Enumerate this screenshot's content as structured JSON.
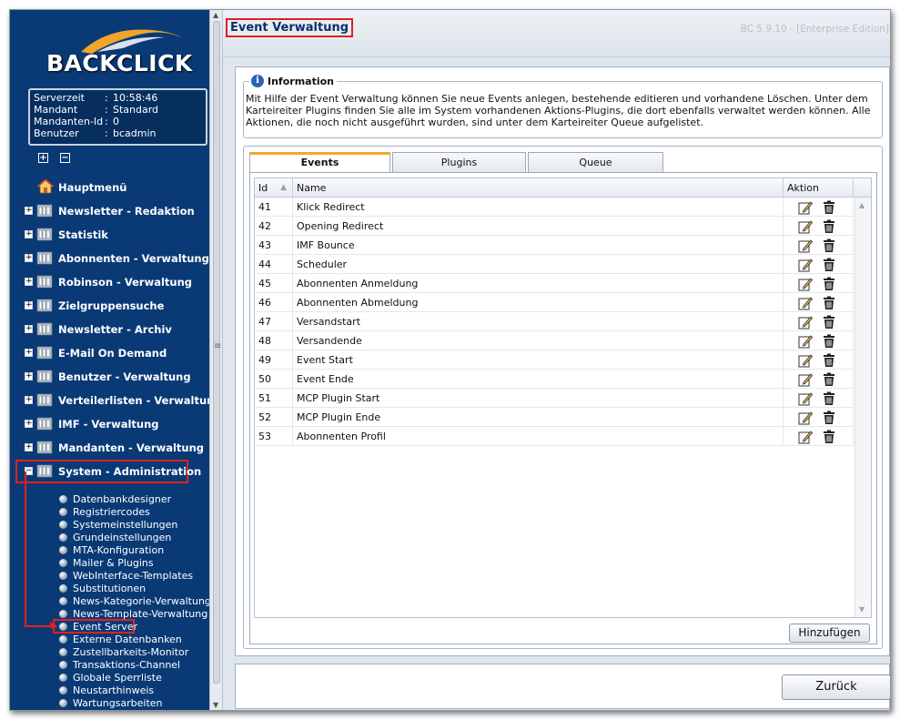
{
  "sidebar": {
    "logo_text": "BACKCLICK",
    "server_info": [
      {
        "key": "Serverzeit",
        "value": "10:58:46"
      },
      {
        "key": "Mandant",
        "value": "Standard"
      },
      {
        "key": "Mandanten-Id",
        "value": "0"
      },
      {
        "key": "Benutzer",
        "value": "bcadmin"
      }
    ],
    "expand_all": "+",
    "collapse_all": "−",
    "home_label": "Hauptmenü",
    "items": [
      {
        "label": "Newsletter - Redaktion",
        "toggle": "+"
      },
      {
        "label": "Statistik",
        "toggle": "+"
      },
      {
        "label": "Abonnenten - Verwaltung",
        "toggle": "+"
      },
      {
        "label": "Robinson - Verwaltung",
        "toggle": "+"
      },
      {
        "label": "Zielgruppensuche",
        "toggle": "+"
      },
      {
        "label": "Newsletter - Archiv",
        "toggle": "+"
      },
      {
        "label": "E-Mail On Demand",
        "toggle": "+"
      },
      {
        "label": "Benutzer - Verwaltung",
        "toggle": "+"
      },
      {
        "label": "Verteilerlisten - Verwaltung",
        "toggle": "+"
      },
      {
        "label": "IMF - Verwaltung",
        "toggle": "+"
      },
      {
        "label": "Mandanten - Verwaltung",
        "toggle": "+"
      },
      {
        "label": "System - Administration",
        "toggle": "−"
      }
    ],
    "sub_items": [
      "Datenbankdesigner",
      "Registriercodes",
      "Systemeinstellungen",
      "Grundeinstellungen",
      "MTA-Konfiguration",
      "Mailer & Plugins",
      "WebInterface-Templates",
      "Substitutionen",
      "News-Kategorie-Verwaltung",
      "News-Template-Verwaltung",
      "Event Server",
      "Externe Datenbanken",
      "Zustellbarkeits-Monitor",
      "Transaktions-Channel",
      "Globale Sperrliste",
      "Neustarthinweis",
      "Wartungsarbeiten"
    ],
    "active_item": "System - Administration",
    "active_sub_item": "Event Server",
    "accent_color": "#093a76",
    "highlight_color": "#e02020"
  },
  "header": {
    "title": "Event Verwaltung",
    "version": "BC 5.9.10 - [Enterprise Edition]"
  },
  "information": {
    "legend": "Information",
    "icon": "i",
    "text": "Mit Hilfe der Event Verwaltung können Sie neue Events anlegen, bestehende editieren und vorhandene Löschen. Unter dem Karteireiter Plugins finden Sie alle im System vorhandenen Aktions-Plugins, die dort ebenfalls verwaltet werden können. Alle Aktionen, die noch nicht ausgeführt wurden, sind unter dem Karteireiter Queue aufgelistet."
  },
  "tabs": [
    {
      "label": "Events",
      "active": true
    },
    {
      "label": "Plugins",
      "active": false
    },
    {
      "label": "Queue",
      "active": false
    }
  ],
  "grid": {
    "columns": {
      "id": "Id",
      "name": "Name",
      "action": "Aktion"
    },
    "sort_indicator": "▲",
    "rows": [
      {
        "id": "41",
        "name": "Klick Redirect"
      },
      {
        "id": "42",
        "name": "Opening Redirect"
      },
      {
        "id": "43",
        "name": "IMF Bounce"
      },
      {
        "id": "44",
        "name": "Scheduler"
      },
      {
        "id": "45",
        "name": "Abonnenten Anmeldung"
      },
      {
        "id": "46",
        "name": "Abonnenten Abmeldung"
      },
      {
        "id": "47",
        "name": "Versandstart"
      },
      {
        "id": "48",
        "name": "Versandende"
      },
      {
        "id": "49",
        "name": "Event Start"
      },
      {
        "id": "50",
        "name": "Event Ende"
      },
      {
        "id": "51",
        "name": "MCP Plugin Start"
      },
      {
        "id": "52",
        "name": "MCP Plugin Ende"
      },
      {
        "id": "53",
        "name": "Abonnenten Profil"
      }
    ],
    "row_actions": [
      "edit-icon",
      "delete-icon"
    ]
  },
  "buttons": {
    "add": "Hinzufügen",
    "back": "Zurück"
  }
}
